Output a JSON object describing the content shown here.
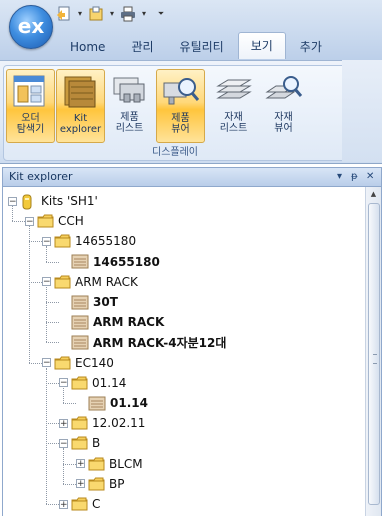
{
  "app": {
    "logo_text": "ex",
    "tabs": [
      {
        "label": "Home",
        "active": false
      },
      {
        "label": "관리",
        "active": false
      },
      {
        "label": "유틸리티",
        "active": false
      },
      {
        "label": "보기",
        "active": true
      },
      {
        "label": "추가",
        "active": false
      }
    ]
  },
  "ribbon": {
    "group_name": "디스플레이",
    "buttons": [
      {
        "line1": "오더",
        "line2": "탐색기",
        "icon": "order-explorer-icon",
        "highlighted": true
      },
      {
        "line1": "Kit",
        "line2": "explorer",
        "icon": "kit-explorer-icon",
        "highlighted": true
      },
      {
        "line1": "제품",
        "line2": "리스트",
        "icon": "product-list-icon",
        "highlighted": false
      },
      {
        "line1": "제품",
        "line2": "뷰어",
        "icon": "product-viewer-icon",
        "highlighted": true
      },
      {
        "line1": "자재",
        "line2": "리스트",
        "icon": "material-list-icon",
        "highlighted": false
      },
      {
        "line1": "자재",
        "line2": "뷰어",
        "icon": "material-viewer-icon",
        "highlighted": false
      }
    ]
  },
  "pane": {
    "title": "Kit explorer",
    "controls": {
      "dropdown": "▾",
      "pin": "ᵽ",
      "close": "✕"
    }
  },
  "tree": [
    {
      "label": "Kits 'SH1'",
      "kind": "root",
      "level": 0,
      "expander": "−"
    },
    {
      "label": "CCH",
      "kind": "folder",
      "level": 1,
      "expander": "−"
    },
    {
      "label": "14655180",
      "kind": "folder",
      "level": 2,
      "expander": "−"
    },
    {
      "label": "14655180",
      "kind": "item",
      "level": 3,
      "bold": true
    },
    {
      "label": "ARM RACK",
      "kind": "folder",
      "level": 2,
      "expander": "−"
    },
    {
      "label": "30T",
      "kind": "item",
      "level": 3,
      "bold": true
    },
    {
      "label": "ARM RACK",
      "kind": "item",
      "level": 3,
      "bold": true
    },
    {
      "label": "ARM RACK-4자분12대",
      "kind": "item",
      "level": 3,
      "bold": true
    },
    {
      "label": "EC140",
      "kind": "folder",
      "level": 2,
      "expander": "−"
    },
    {
      "label": "01.14",
      "kind": "folder",
      "level": 3,
      "expander": "−"
    },
    {
      "label": "01.14",
      "kind": "item",
      "level": 4,
      "bold": true
    },
    {
      "label": "12.02.11",
      "kind": "folder",
      "level": 3,
      "expander": "+"
    },
    {
      "label": "B",
      "kind": "folder",
      "level": 3,
      "expander": "−"
    },
    {
      "label": "BLCM",
      "kind": "folder",
      "level": 4,
      "expander": "+"
    },
    {
      "label": "BP",
      "kind": "folder",
      "level": 4,
      "expander": "+"
    },
    {
      "label": "C",
      "kind": "folder",
      "level": 3,
      "expander": "+"
    }
  ]
}
